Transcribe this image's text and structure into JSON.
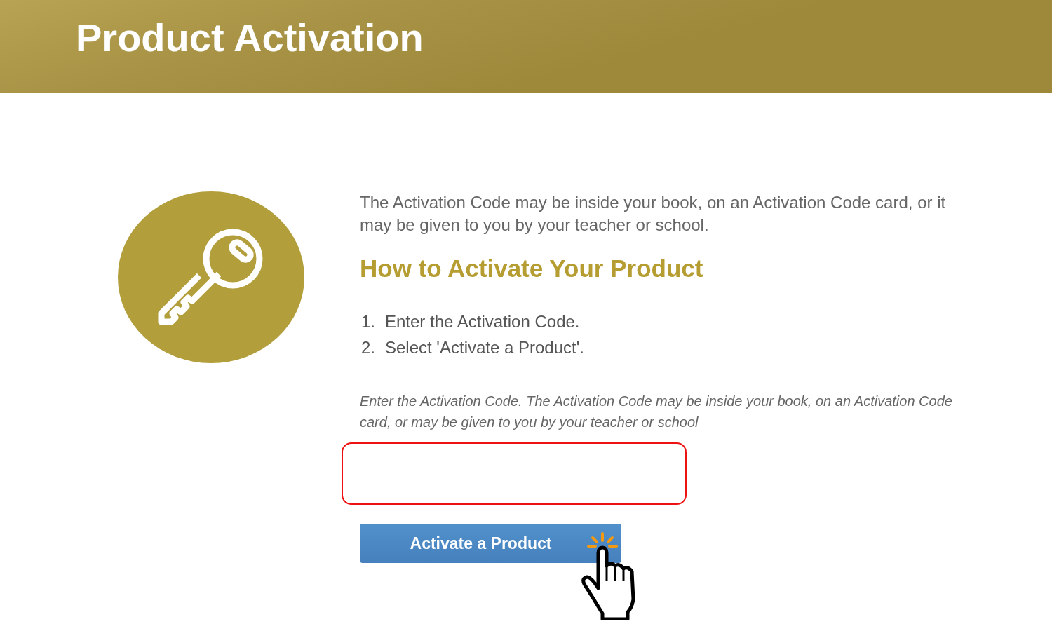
{
  "header": {
    "title": "Product Activation"
  },
  "intro": "The Activation Code may be inside your book, on an Activation Code card, or it may be given to you by your teacher or school.",
  "heading": "How to Activate Your Product",
  "steps": [
    {
      "number": "1.",
      "text": "Enter the Activation Code."
    },
    {
      "number": "2.",
      "text": "Select 'Activate a Product'."
    }
  ],
  "field_hint": "Enter the Activation Code. The Activation Code may be inside your book, on an Activation Code card, or may be given to you by your teacher or school",
  "code_field": {
    "invalid": true
  },
  "button": {
    "label": "Activate a Product"
  }
}
